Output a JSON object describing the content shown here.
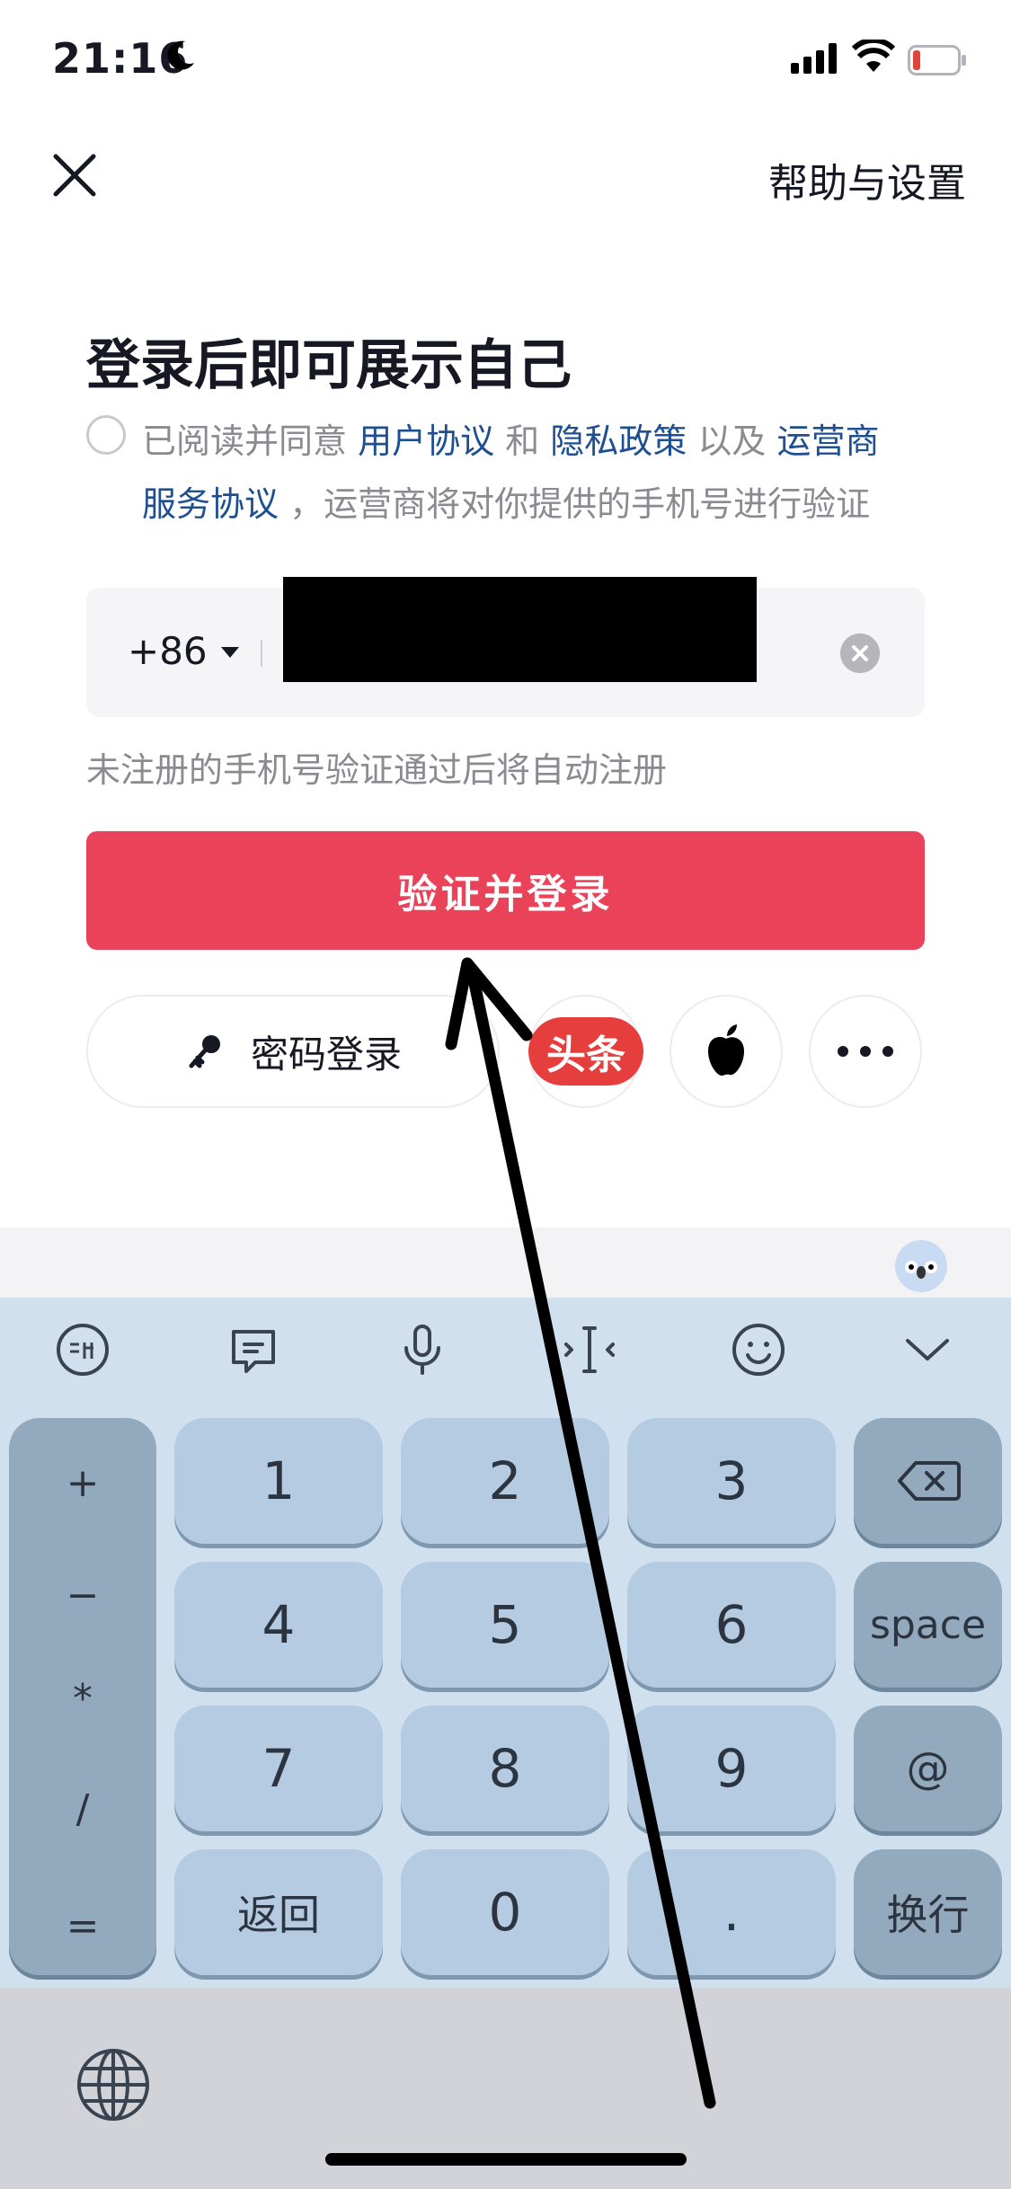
{
  "status_bar": {
    "time": "21:16",
    "icons": [
      "moon-icon",
      "signal-icon",
      "wifi-icon",
      "battery-icon"
    ]
  },
  "header": {
    "close_icon": "close-icon",
    "help_label": "帮助与设置"
  },
  "title": "登录后即可展示自己",
  "agreement": {
    "prefix": "已阅读并同意 ",
    "user_agreement": "用户协议",
    "and": " 和 ",
    "privacy_policy": "隐私政策",
    "as_well_as": " 以及 ",
    "carrier_1": "运营商",
    "carrier_2": "服务协议",
    "suffix": " ，运营商将对你提供的手机号进行验证"
  },
  "phone": {
    "country_code": "+86"
  },
  "hint": "未注册的手机号验证通过后将自动注册",
  "login_button": "验证并登录",
  "password_login": "密码登录",
  "toutiao_label": "头条",
  "keyboard": {
    "symbols": [
      "+",
      "−",
      "*",
      "/",
      "="
    ],
    "digits": [
      "1",
      "2",
      "3",
      "4",
      "5",
      "6",
      "7",
      "8",
      "9"
    ],
    "back": "返回",
    "zero": "0",
    "dot": ".",
    "space": "space",
    "at": "@",
    "enter": "换行"
  },
  "colors": {
    "accent": "#ea4259",
    "link": "#1d4f91",
    "toutiao": "#e63d3d"
  }
}
